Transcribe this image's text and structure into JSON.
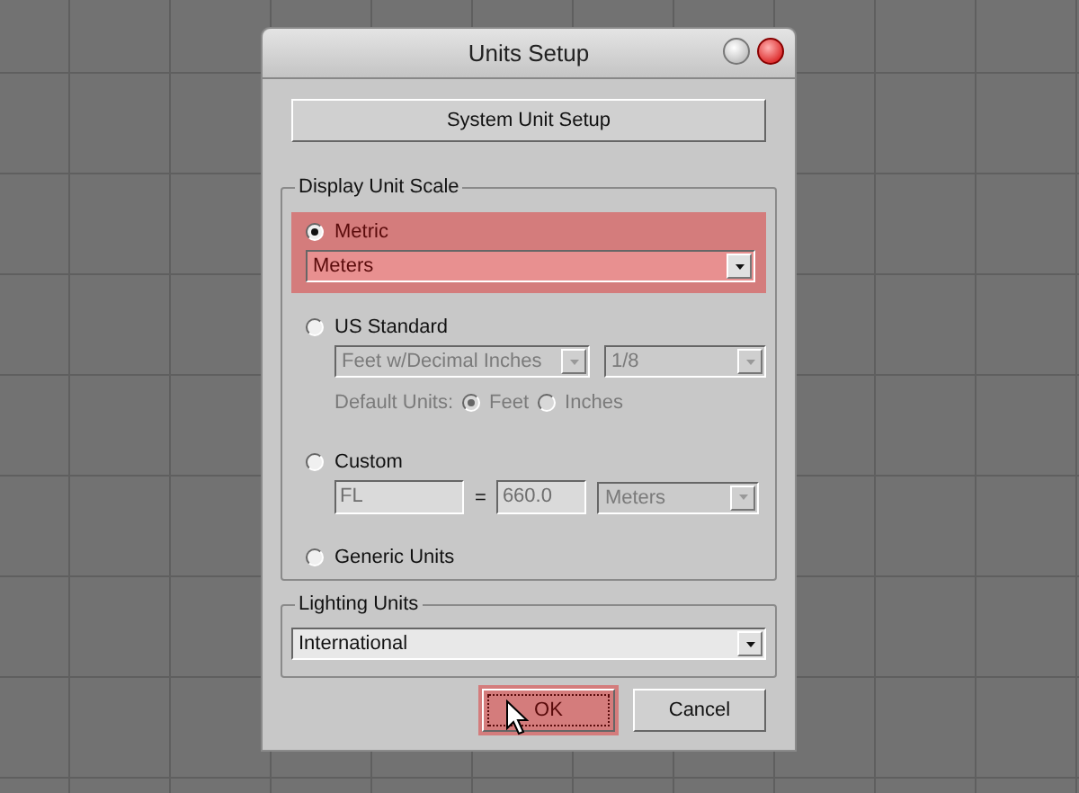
{
  "window": {
    "title": "Units Setup"
  },
  "system_unit_button": {
    "label": "System Unit Setup"
  },
  "display_unit_scale": {
    "title": "Display Unit Scale",
    "metric": {
      "label": "Metric",
      "selected": true,
      "highlighted": true,
      "dropdown": {
        "value": "Meters",
        "disabled": false
      }
    },
    "us_standard": {
      "label": "US Standard",
      "selected": false,
      "format": {
        "value": "Feet w/Decimal Inches",
        "disabled": true
      },
      "fraction": {
        "value": "1/8",
        "disabled": true
      },
      "default_units": {
        "label": "Default Units:",
        "disabled": true,
        "options": [
          {
            "label": "Feet",
            "selected": true
          },
          {
            "label": "Inches",
            "selected": false
          }
        ]
      }
    },
    "custom": {
      "label": "Custom",
      "selected": false,
      "name_field": {
        "value": "FL",
        "disabled": true
      },
      "equals": "=",
      "value_field": {
        "value": "660.0",
        "disabled": true
      },
      "unit": {
        "value": "Meters",
        "disabled": true
      }
    },
    "generic": {
      "label": "Generic Units",
      "selected": false
    }
  },
  "lighting_units": {
    "title": "Lighting Units",
    "dropdown": {
      "value": "International",
      "disabled": false
    }
  },
  "buttons": [
    {
      "label": "OK",
      "highlighted": true
    },
    {
      "label": "Cancel",
      "highlighted": false
    }
  ]
}
